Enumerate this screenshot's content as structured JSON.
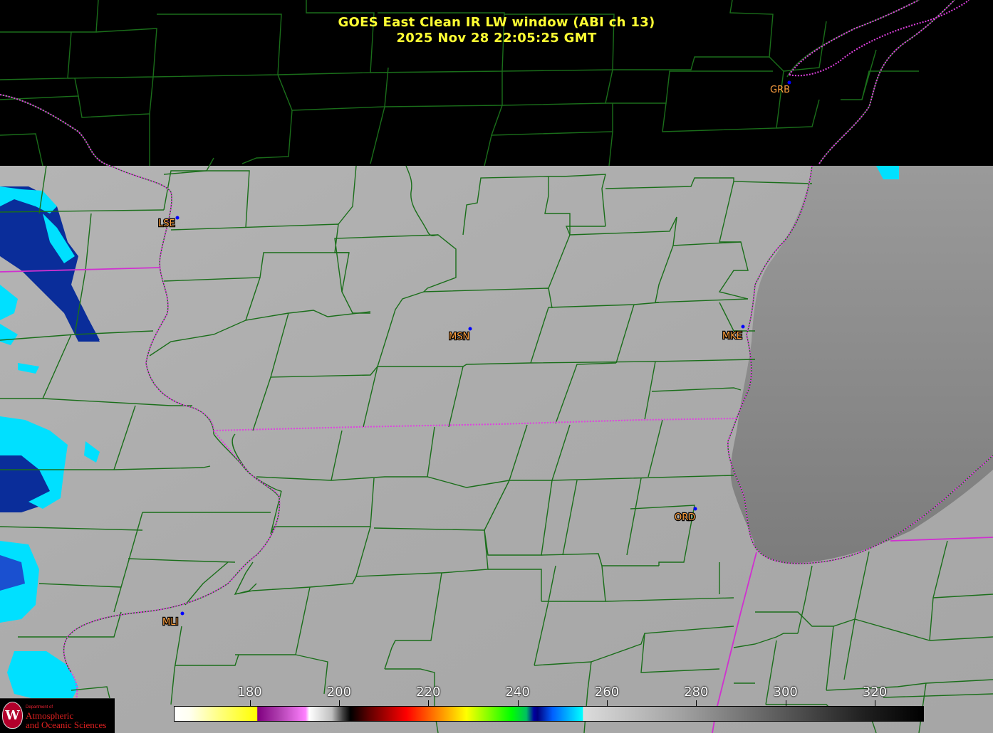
{
  "title": {
    "line1": "GOES East Clean IR LW window (ABI ch 13)",
    "line2": "2025 Nov 28  22:05:25 GMT"
  },
  "stations": [
    {
      "id": "GRB",
      "label": "GRB"
    },
    {
      "id": "LSE",
      "label": "LSE"
    },
    {
      "id": "MSN",
      "label": "MSN"
    },
    {
      "id": "MKE",
      "label": "MKE"
    },
    {
      "id": "ORD",
      "label": "ORD"
    },
    {
      "id": "MLI",
      "label": "MLI"
    }
  ],
  "colorbar": {
    "ticks": [
      "180",
      "200",
      "220",
      "240",
      "260",
      "280",
      "300",
      "320"
    ],
    "tick_values": [
      180,
      200,
      220,
      240,
      260,
      280,
      300,
      320
    ],
    "range": [
      163,
      331
    ]
  },
  "logo": {
    "seal_letter": "W",
    "dept": "Department of",
    "line1": "Atmospheric",
    "line2": "and Oceanic Sciences"
  },
  "colors": {
    "title": "#ffff33",
    "county_lines": "#1a6e1a",
    "state_lines": "#e040e0",
    "label_text": "#ffa040",
    "station_dot": "#0000ff",
    "land_gray": "#a9a9a9",
    "lake_gray": "#8c8c8c"
  }
}
